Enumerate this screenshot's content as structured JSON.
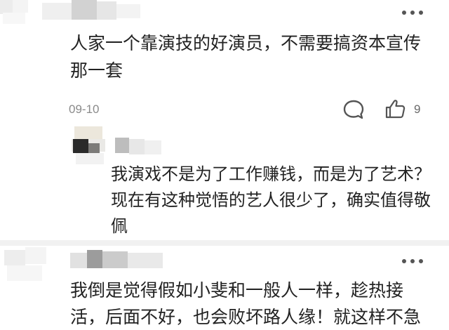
{
  "comments": [
    {
      "text_lines": [
        "人家一个靠演技的好演员，不需要搞资本宣传",
        "那一套"
      ],
      "date": "09-10",
      "like_count": "9",
      "more_icon": "more-dots-icon",
      "reply_icon": "comment-bubble-icon",
      "like_icon": "thumbs-up-icon"
    },
    {
      "text_lines": [
        "我演戏不是为了工作赚钱，而是为了艺术？",
        "现在有这种觉悟的艺人很少了，确实值得敬",
        "佩"
      ]
    },
    {
      "text_lines": [
        "我倒是觉得假如小斐和一般人一样，趁热接",
        "活，后面不好，也会败坏路人缘！就这样不急"
      ],
      "more_icon": "more-dots-icon"
    }
  ],
  "colors": {
    "text": "#222222",
    "meta": "#8a8a8a",
    "icon": "#555555",
    "divider": "#f1f1f1"
  }
}
